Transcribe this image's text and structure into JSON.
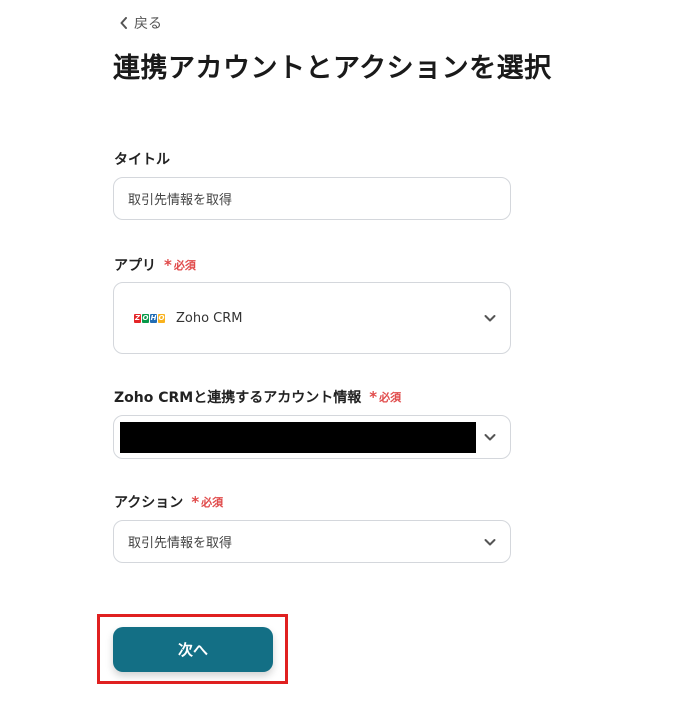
{
  "back": {
    "label": "戻る"
  },
  "page": {
    "title": "連携アカウントとアクションを選択"
  },
  "required_mark": "必須",
  "fields": {
    "title": {
      "label": "タイトル",
      "value": "取引先情報を取得"
    },
    "app": {
      "label": "アプリ",
      "value": "Zoho CRM",
      "logo_letters": [
        "Z",
        "O",
        "H",
        "O"
      ],
      "logo_colors": [
        "#e42527",
        "#089949",
        "#226db4",
        "#f9b21d"
      ]
    },
    "account": {
      "label": "Zoho CRMと連携するアカウント情報"
    },
    "action": {
      "label": "アクション",
      "value": "取引先情報を取得"
    }
  },
  "buttons": {
    "next": "次へ"
  },
  "colors": {
    "primary": "#136f85",
    "required": "#e04a4a",
    "highlight": "#e02020"
  }
}
